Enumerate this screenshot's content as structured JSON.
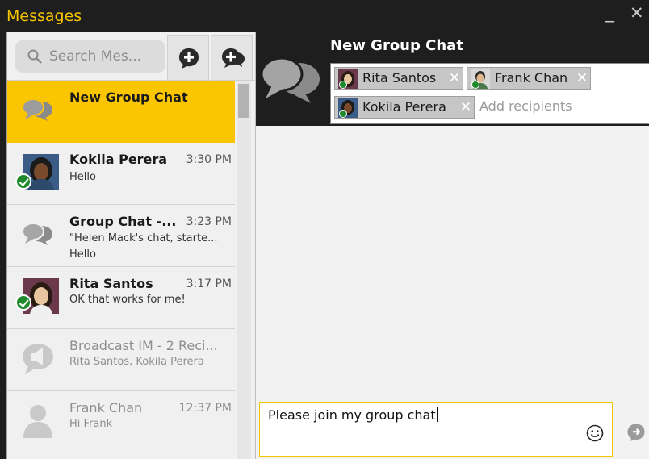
{
  "window": {
    "title": "Messages",
    "minimize_glyph": "_",
    "close_glyph": "✕"
  },
  "toolbar": {
    "search_placeholder": "Search Mes...",
    "new_chat_icon": "plus-bubble-icon",
    "new_group_icon": "plus-group-bubble-icon"
  },
  "conversations": [
    {
      "name": "New Group Chat",
      "time": "",
      "lines": [],
      "avatar": "group-chat-icon",
      "selected": true,
      "status": "none"
    },
    {
      "name": "Kokila Perera",
      "time": "3:30 PM",
      "lines": [
        "Hello"
      ],
      "avatar": "photo-kokila",
      "status": "available"
    },
    {
      "name": "Group Chat -...",
      "time": "3:23 PM",
      "lines": [
        "\"Helen Mack's chat, starte...",
        "Hello"
      ],
      "avatar": "group-chat-icon",
      "status": "none"
    },
    {
      "name": "Rita Santos",
      "time": "3:17 PM",
      "lines": [
        "OK that works for me!"
      ],
      "avatar": "photo-rita",
      "status": "available"
    },
    {
      "name": "Broadcast IM - 2 Reci...",
      "time": "",
      "lines": [
        "Rita Santos, Kokila Perera"
      ],
      "avatar": "broadcast-icon",
      "status": "offline"
    },
    {
      "name": "Frank Chan",
      "time": "12:37 PM",
      "lines": [
        "Hi Frank"
      ],
      "avatar": "person-placeholder-icon",
      "status": "offline"
    }
  ],
  "chat": {
    "title": "New Group Chat",
    "header_icon": "group-chat-icon",
    "recipients": [
      {
        "name": "Rita Santos",
        "avatar": "photo-rita"
      },
      {
        "name": "Frank Chan",
        "avatar": "photo-frank"
      },
      {
        "name": "Kokila Perera",
        "avatar": "photo-kokila"
      }
    ],
    "add_recipients_placeholder": "Add recipients",
    "compose_text": "Please join my group chat"
  },
  "colors": {
    "accent": "#fbc600",
    "title_text": "#f5c400",
    "dark_bg": "#1e1e1e",
    "status_available": "#1f8a2c"
  }
}
